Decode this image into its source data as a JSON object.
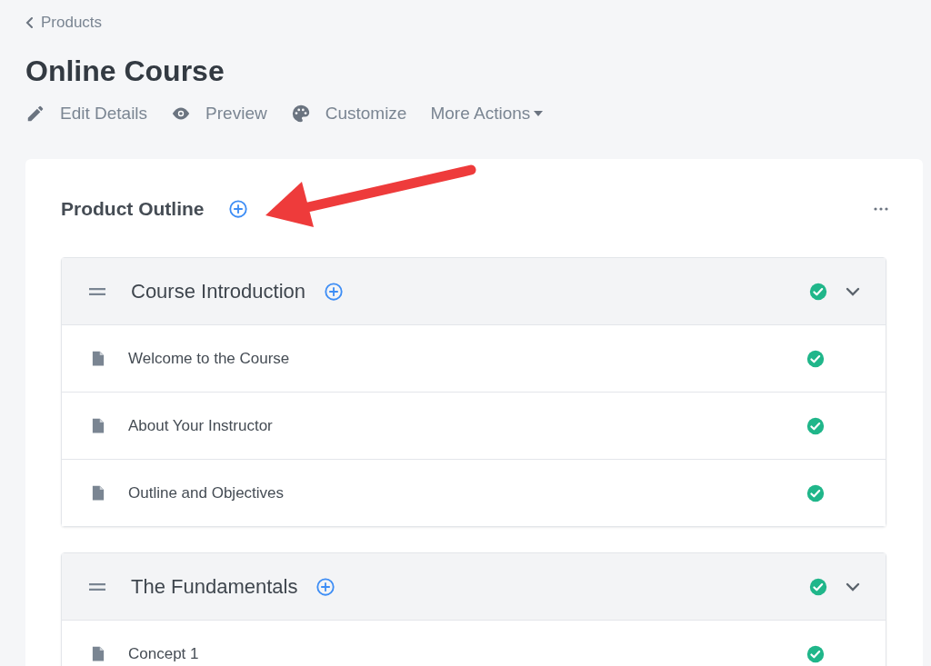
{
  "breadcrumb": {
    "label": "Products"
  },
  "title": "Online Course",
  "actions": [
    {
      "kind": "edit",
      "label": "Edit Details"
    },
    {
      "kind": "preview",
      "label": "Preview"
    },
    {
      "kind": "customize",
      "label": "Customize"
    },
    {
      "kind": "more",
      "label": "More Actions"
    }
  ],
  "outline": {
    "title": "Product Outline",
    "sections": [
      {
        "title": "Course Introduction",
        "completed": true,
        "expanded": true,
        "lessons": [
          {
            "title": "Welcome to the Course",
            "completed": true
          },
          {
            "title": "About Your Instructor",
            "completed": true
          },
          {
            "title": "Outline and Objectives",
            "completed": true
          }
        ]
      },
      {
        "title": "The Fundamentals",
        "completed": true,
        "expanded": true,
        "lessons": [
          {
            "title": "Concept 1",
            "completed": true
          }
        ]
      }
    ]
  }
}
